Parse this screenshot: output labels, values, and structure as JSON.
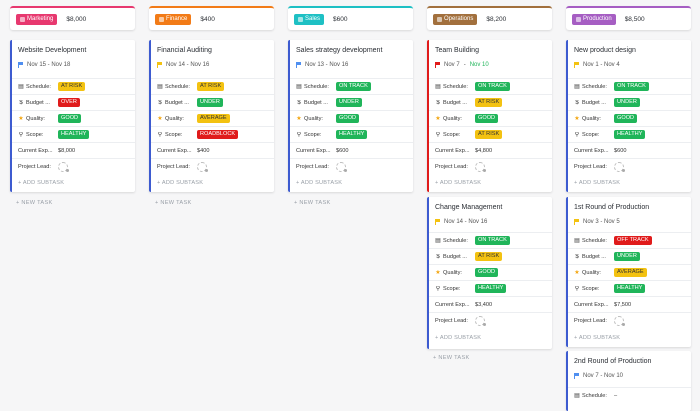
{
  "columns": [
    {
      "label": "Marketing",
      "amount": "$8,000",
      "color": "#e7386f"
    },
    {
      "label": "Finance",
      "amount": "$400",
      "color": "#f27b17"
    },
    {
      "label": "Sales",
      "amount": "$600",
      "color": "#1ec0c4"
    },
    {
      "label": "Operations",
      "amount": "$8,200",
      "color": "#a2703d"
    },
    {
      "label": "Production",
      "amount": "$8,500",
      "color": "#a65ec3"
    }
  ],
  "field_labels": {
    "schedule": "Schedule:",
    "budget": "Budget ...",
    "quality": "Quality:",
    "scope": "Scope:",
    "expense": "Current Exp...",
    "lead": "Project Lead:"
  },
  "add_subtask": "+ ADD SUBTASK",
  "new_task": "+ NEW TASK",
  "cards": [
    {
      "title": "Website Development",
      "dates": "Nov 15 - Nov 18",
      "flag_color": "#4f8ff0",
      "schedule": "AT RISK",
      "budget": "OVER",
      "quality": "GOOD",
      "scope": "HEALTHY",
      "expense": "$8,000"
    },
    {
      "title": "Financial Auditing",
      "dates": "Nov 14 - Nov 16",
      "flag_color": "#f3c211",
      "schedule": "AT RISK",
      "budget": "UNDER",
      "quality": "AVERAGE",
      "scope": "ROADBLOCK",
      "expense": "$400"
    },
    {
      "title": "Sales strategy development",
      "dates": "Nov 13 - Nov 16",
      "flag_color": "#4f8ff0",
      "schedule": "ON TRACK",
      "budget": "UNDER",
      "quality": "GOOD",
      "scope": "HEALTHY",
      "expense": "$600"
    },
    {
      "title": "Team Building",
      "dates_start": "Nov 7",
      "dates_end": "Nov 10",
      "flag_color": "#e01b1b",
      "schedule": "ON TRACK",
      "budget": "AT RISK",
      "quality": "GOOD",
      "scope": "AT RISK",
      "expense": "$4,800"
    },
    {
      "title": "Change Management",
      "dates": "Nov 14 - Nov 16",
      "flag_color": "#f3c211",
      "schedule": "ON TRACK",
      "budget": "AT RISK",
      "quality": "GOOD",
      "scope": "HEALTHY",
      "expense": "$3,400"
    },
    {
      "title": "New product design",
      "dates": "Nov 1 - Nov 4",
      "flag_color": "#f3c211",
      "schedule": "ON TRACK",
      "budget": "UNDER",
      "quality": "GOOD",
      "scope": "HEALTHY",
      "expense": "$600"
    },
    {
      "title": "1st Round of Production",
      "dates": "Nov 3 - Nov 5",
      "flag_color": "#f3c211",
      "schedule": "OFF TRACK",
      "budget": "UNDER",
      "quality": "AVERAGE",
      "scope": "HEALTHY",
      "expense": "$7,500"
    },
    {
      "title": "2nd Round of Production",
      "dates": "Nov 7 - Nov 10",
      "flag_color": "#4f8ff0",
      "schedule": "–"
    }
  ]
}
